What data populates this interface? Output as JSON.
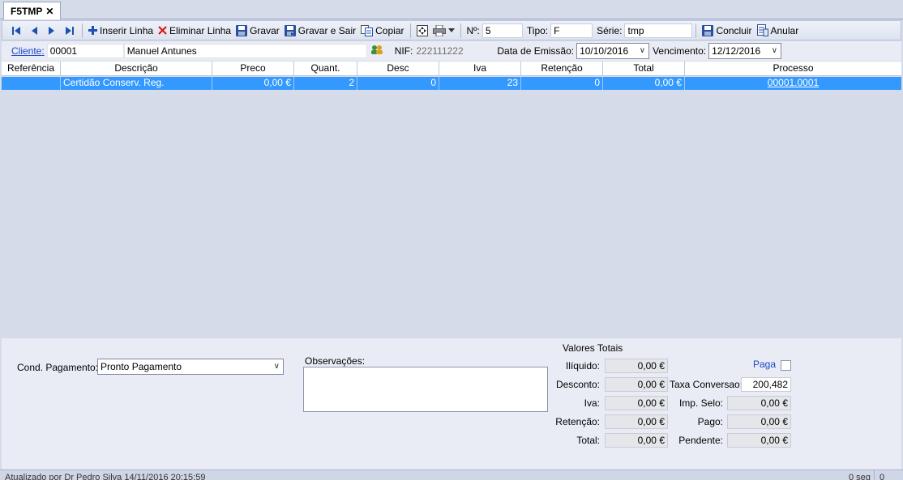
{
  "tab": {
    "title": "F5TMP",
    "close_glyph": "✕"
  },
  "toolbar": {
    "insert_label": "Inserir Linha",
    "delete_label": "Eliminar Linha",
    "save_label": "Gravar",
    "save_exit_label": "Gravar e Sair",
    "copy_label": "Copiar",
    "number_label": "Nº:",
    "number_value": "5",
    "type_label": "Tipo:",
    "type_value": "F",
    "series_label": "Série:",
    "series_value": "tmp",
    "conclude_label": "Concluir",
    "cancel_label": "Anular"
  },
  "client": {
    "label": "Cliente:",
    "code": "00001",
    "name": "Manuel Antunes",
    "nif_label": "NIF:",
    "nif_value": "222111222",
    "issue_date_label": "Data de Emissão:",
    "issue_date": "10/10/2016",
    "due_label": "Vencimento:",
    "due_date": "12/12/2016"
  },
  "grid": {
    "columns": [
      "Referência",
      "Descrição",
      "Preco",
      "Quant.",
      "Desc",
      "Iva",
      "Retenção",
      "Total",
      "Processo"
    ],
    "rows": [
      {
        "referencia": "",
        "descricao": "Certidão Conserv. Reg. Comercial",
        "preco": "0,00 €",
        "quant": "2",
        "desc": "0",
        "iva": "23",
        "retencao": "0",
        "total": "0,00 €",
        "processo": "00001.0001"
      }
    ]
  },
  "footer": {
    "payment_label": "Cond. Pagamento:",
    "payment_value": "Pronto Pagamento",
    "notes_label": "Observações:",
    "notes_value": "",
    "totals_title": "Valores Totais",
    "liquido_label": "Ilíquido:",
    "liquido_value": "0,00 €",
    "desconto_label": "Desconto:",
    "desconto_value": "0,00 €",
    "iva_label": "Iva:",
    "iva_value": "0,00 €",
    "retencao_label": "Retenção:",
    "retencao_value": "0,00 €",
    "total_label": "Total:",
    "total_value": "0,00 €",
    "paga_label": "Paga",
    "taxa_label": "Taxa Conversao:",
    "taxa_value": "200,482",
    "selo_label": "Imp. Selo:",
    "selo_value": "0,00 €",
    "pago_label": "Pago:",
    "pago_value": "0,00 €",
    "pendente_label": "Pendente:",
    "pendente_value": "0,00 €"
  },
  "status": {
    "updated_text": "Atualizado por Dr Pedro Silva 14/11/2016 20:15:59",
    "time_text": "0 seg",
    "count_text": "0"
  },
  "colors": {
    "selection": "#3399ff",
    "link": "#1a45c9",
    "panel": "#e9ecf4"
  }
}
